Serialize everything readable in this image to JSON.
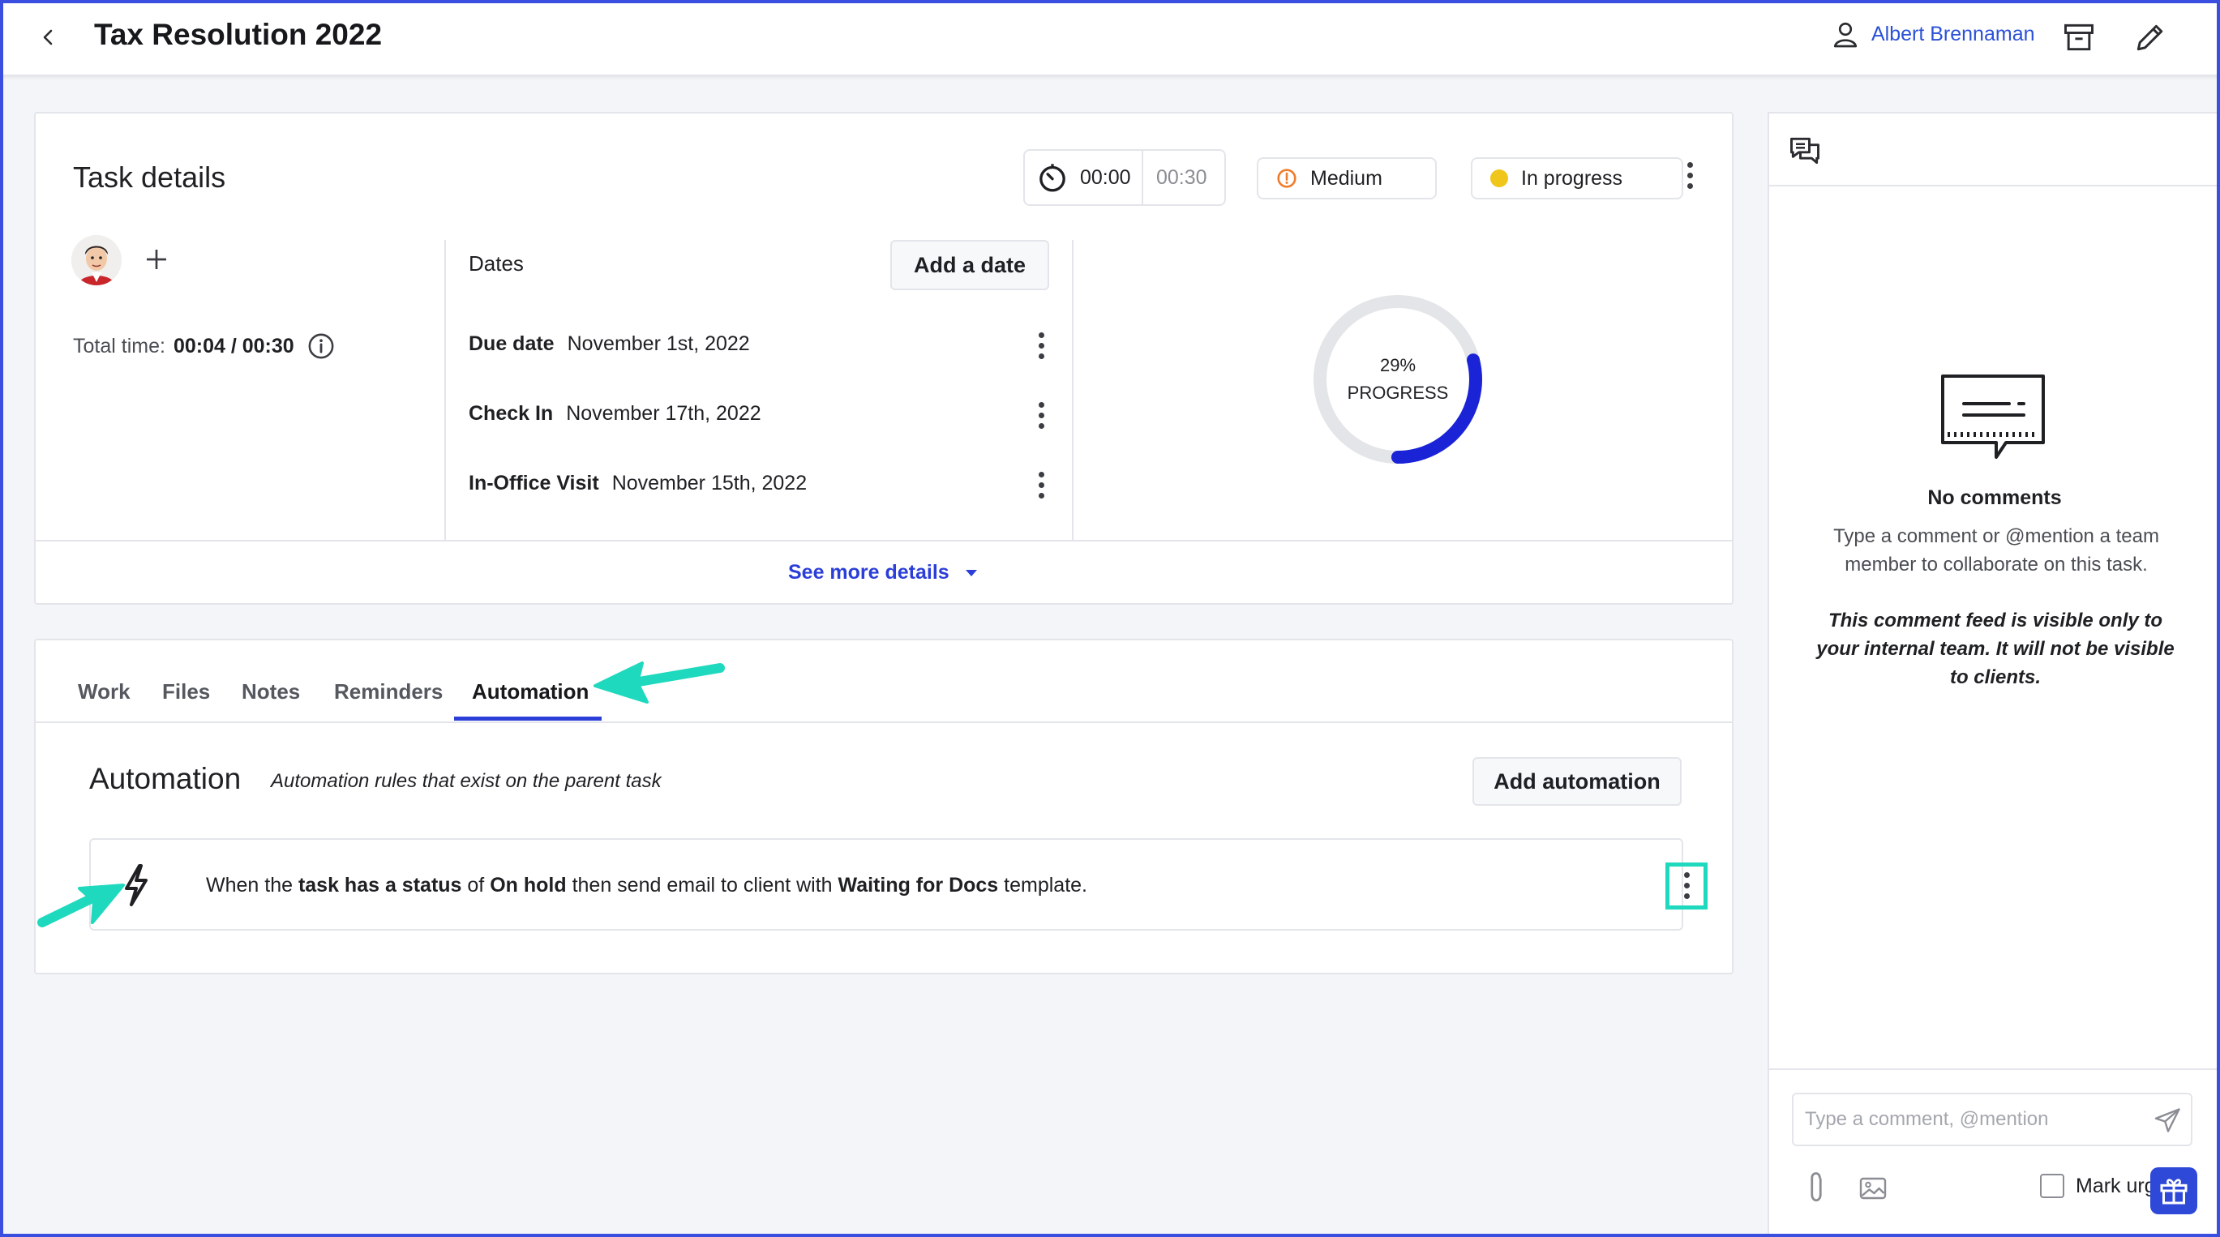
{
  "header": {
    "title": "Tax Resolution 2022",
    "user_name": "Albert Brennaman"
  },
  "task_details": {
    "title": "Task details",
    "timer": {
      "elapsed": "00:00",
      "estimate": "00:30"
    },
    "priority": {
      "label": "Medium",
      "color": "#f07c2b"
    },
    "status": {
      "label": "In progress",
      "color": "#f1c61a"
    },
    "total_time": {
      "label": "Total time:",
      "value": "00:04 / 00:30"
    },
    "dates": {
      "label": "Dates",
      "add_label": "Add a date",
      "items": [
        {
          "label": "Due date",
          "value": "November 1st, 2022"
        },
        {
          "label": "Check In",
          "value": "November 17th, 2022"
        },
        {
          "label": "In-Office Visit",
          "value": "November 15th, 2022"
        }
      ]
    },
    "progress": {
      "percent_label": "29%",
      "label": "PROGRESS",
      "fraction": 0.29,
      "color": "#1a23d6"
    },
    "see_more_label": "See more details"
  },
  "tabs": [
    {
      "label": "Work"
    },
    {
      "label": "Files"
    },
    {
      "label": "Notes"
    },
    {
      "label": "Reminders"
    },
    {
      "label": "Automation",
      "active": true
    }
  ],
  "automation": {
    "title": "Automation",
    "subtitle": "Automation rules that exist on the parent task",
    "add_label": "Add automation",
    "rule": {
      "p1": "When the ",
      "b1": "task has a status",
      "p2": " of ",
      "b2": "On hold",
      "p3": " then send email to client with ",
      "b3": "Waiting for Docs",
      "p4": " template."
    }
  },
  "comments": {
    "empty_title": "No comments",
    "empty_message": "Type a comment or @mention a team member to collaborate on this task.",
    "visibility_note": "This comment feed is visible only to your internal team. It will not be visible to clients.",
    "input_placeholder": "Type a comment, @mention",
    "mark_urgent_label": "Mark urgent"
  },
  "colors": {
    "accent": "#2b3fd8",
    "highlight": "#1ed9bd"
  },
  "icons": [
    "back-icon",
    "user-icon",
    "archive-icon",
    "pencil-icon",
    "timer-icon",
    "alert-icon",
    "kebab-icon",
    "plus-icon",
    "info-icon",
    "caret-down-icon",
    "lightning-icon",
    "chat-icon",
    "send-icon",
    "paperclip-icon",
    "image-icon",
    "gift-icon"
  ]
}
